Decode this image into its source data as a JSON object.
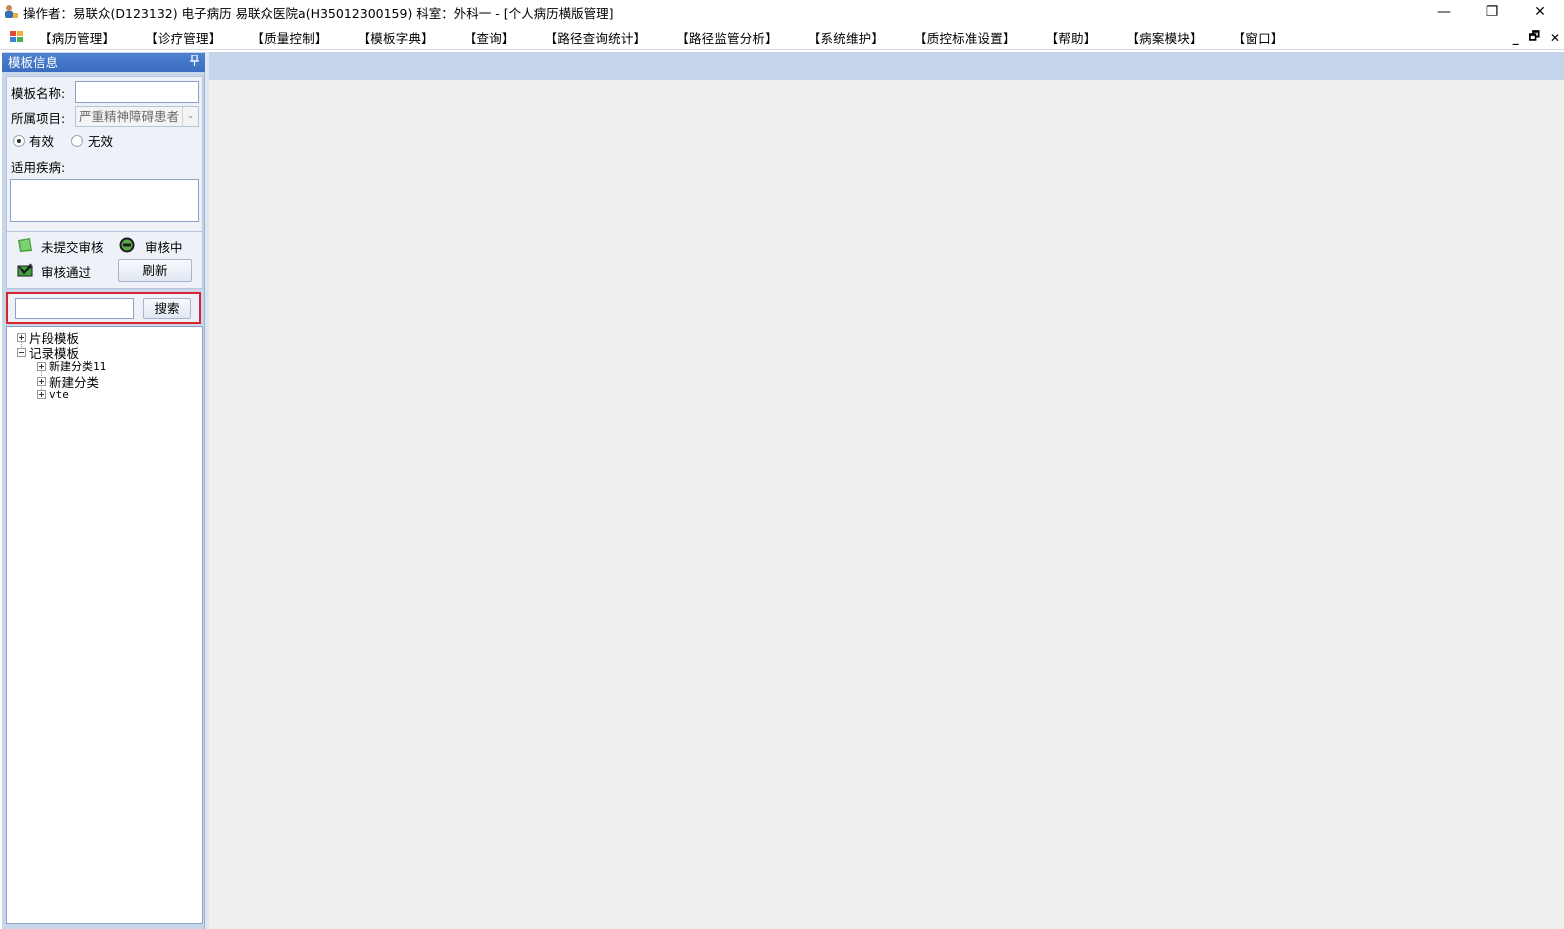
{
  "titlebar": {
    "title": "操作者：易联众(D123132) 电子病历  易联众医院a(H35012300159)  科室：外科一 - [个人病历横版管理]",
    "minimize": "—",
    "restore": "❐",
    "close": "✕"
  },
  "menu": {
    "items": [
      "【病历管理】",
      "【诊疗管理】",
      "【质量控制】",
      "【模板字典】",
      "【查询】",
      "【路径查询统计】",
      "【路径监管分析】",
      "【系统维护】",
      "【质控标准设置】",
      "【帮助】",
      "【病案模块】",
      "【窗口】"
    ],
    "mdi_min": "_",
    "mdi_restore": "🗗",
    "mdi_close": "✕"
  },
  "panel": {
    "header": "模板信息",
    "pin": "ᵽ",
    "template_name_label": "模板名称:",
    "template_name_value": "",
    "project_label": "所属项目:",
    "project_value": "严重精神障碍患者",
    "radio_valid": "有效",
    "radio_invalid": "无效",
    "radio_selected": "有效",
    "disease_label": "适用疾病:",
    "disease_value": ""
  },
  "status_legend": {
    "not_submitted": "未提交审核",
    "reviewing": "审核中",
    "approved": "审核通过",
    "refresh_button": "刷新"
  },
  "search": {
    "value": "",
    "button": "搜索"
  },
  "tree": {
    "nodes": [
      {
        "label": "片段模板",
        "expanded": false
      },
      {
        "label": "记录模板",
        "expanded": true,
        "children": [
          {
            "label": "新建分类11",
            "expanded": false
          },
          {
            "label": "新建分类",
            "expanded": false
          },
          {
            "label": "vte",
            "expanded": false
          }
        ]
      }
    ]
  },
  "colors": {
    "panel_header": "#3f72c6",
    "panel_bg": "#c9d6ea",
    "highlight_border": "#d9242f",
    "main_bg": "#efefef"
  }
}
